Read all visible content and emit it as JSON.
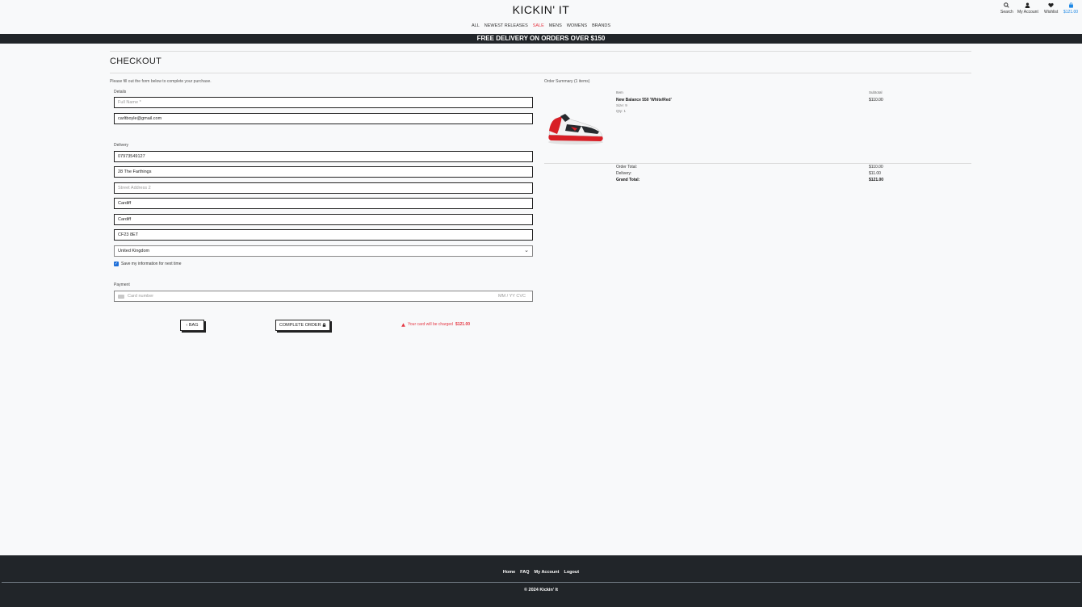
{
  "header": {
    "brand": "KICKIN' IT",
    "search_label": "Search",
    "account_label": "My Account",
    "wishlist_label": "Wishlist",
    "cart_total": "$121.00"
  },
  "nav": [
    {
      "label": "ALL"
    },
    {
      "label": "NEWEST RELEASES"
    },
    {
      "label": "SALE"
    },
    {
      "label": "MENS"
    },
    {
      "label": "WOMENS"
    },
    {
      "label": "BRANDS"
    }
  ],
  "banner": "FREE DELIVERY ON ORDERS OVER $150",
  "page_title": "CHECKOUT",
  "form": {
    "intro": "Please fill out the form below to complete your purchase.",
    "details_label": "Details",
    "full_name_placeholder": "Full Name *",
    "email": "carltboyle@gmail.com",
    "delivery_label": "Delivery",
    "phone": "07973549127",
    "street1": "28 The Farthings",
    "street2_placeholder": "Street Address 2",
    "town": "Cardiff",
    "county": "Cardiff",
    "postcode": "CF23 8ET",
    "country": "United Kingdom",
    "save_info_label": "Save my information for next time",
    "payment_label": "Payment",
    "card_placeholder": "Card number",
    "card_meta": "MM / YY  CVC"
  },
  "buttons": {
    "back_label": "BAG",
    "complete_label": "COMPLETE ORDER"
  },
  "charge_notice": {
    "text": "Your card will be charged",
    "amount": "$121.00"
  },
  "summary": {
    "title": "Order Summary (1 items)",
    "item_col": "Item",
    "subtotal_col": "Subtotal",
    "item": {
      "name": "New Balance 550 'White/Red'",
      "size": "Size: 9",
      "qty": "Qty: 1",
      "price": "$110.00"
    },
    "order_total_label": "Order Total:",
    "order_total": "$110.00",
    "delivery_label": "Delivery:",
    "delivery": "$11.00",
    "grand_total_label": "Grand Total:",
    "grand_total": "$121.00"
  },
  "footer": {
    "links": [
      "Home",
      "FAQ",
      "My Account",
      "Logout"
    ],
    "copyright": "© 2024 Kickin' It"
  },
  "colors": {
    "dark": "#212529",
    "sale": "#e53945",
    "cart": "#1e88e5",
    "checkbox": "#1e6fd9"
  }
}
